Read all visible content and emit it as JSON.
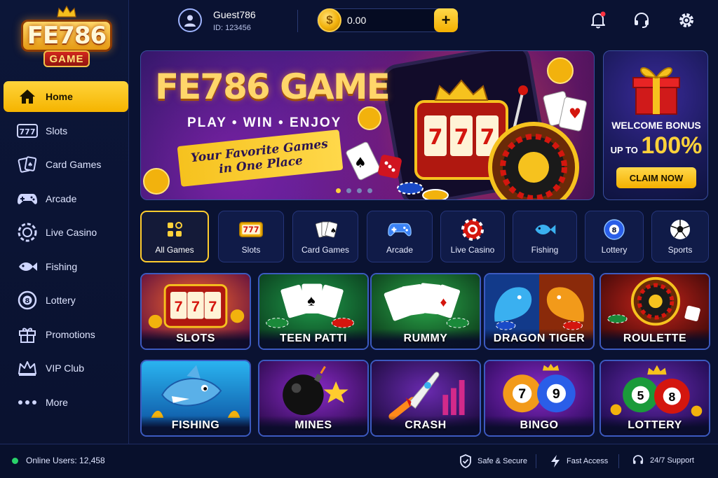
{
  "brand": {
    "logo_main": "FE786",
    "logo_sub": "GAME"
  },
  "sidebar": {
    "items": [
      {
        "label": "Home",
        "icon": "home-icon",
        "active": true
      },
      {
        "label": "Slots",
        "icon": "slots-icon"
      },
      {
        "label": "Card Games",
        "icon": "cards-icon"
      },
      {
        "label": "Arcade",
        "icon": "gamepad-icon"
      },
      {
        "label": "Live Casino",
        "icon": "chip-icon"
      },
      {
        "label": "Fishing",
        "icon": "fish-icon"
      },
      {
        "label": "Lottery",
        "icon": "lottery-ball-icon"
      },
      {
        "label": "Promotions",
        "icon": "gift-icon"
      },
      {
        "label": "VIP Club",
        "icon": "crown-icon"
      },
      {
        "label": "More",
        "icon": "more-dots-icon"
      }
    ]
  },
  "header": {
    "username": "Guest786",
    "user_id": "ID: 123456",
    "balance": "0.00",
    "add_label": "+",
    "coin_symbol": "$"
  },
  "hero": {
    "title": "FE786 GAME",
    "tagline": "PLAY • WIN • ENJOY",
    "slogan_line1": "Your Favorite Games",
    "slogan_line2": "in One Place",
    "slides_total": 4,
    "slide_active": 1
  },
  "bonus": {
    "line1": "WELCOME BONUS",
    "prefix": "UP TO",
    "amount": "100%",
    "claim_label": "CLAIM NOW"
  },
  "categories": [
    {
      "label": "All Games",
      "icon": "grid-icon",
      "active": true
    },
    {
      "label": "Slots",
      "icon": "slots-icon"
    },
    {
      "label": "Card Games",
      "icon": "cards-icon"
    },
    {
      "label": "Arcade",
      "icon": "gamepad-icon"
    },
    {
      "label": "Live Casino",
      "icon": "chip-icon"
    },
    {
      "label": "Fishing",
      "icon": "fish-icon"
    },
    {
      "label": "Lottery",
      "icon": "lottery-ball-icon"
    },
    {
      "label": "Sports",
      "icon": "soccer-ball-icon"
    }
  ],
  "games": [
    {
      "label": "SLOTS"
    },
    {
      "label": "TEEN PATTI"
    },
    {
      "label": "RUMMY"
    },
    {
      "label": "DRAGON TIGER"
    },
    {
      "label": "ROULETTE"
    },
    {
      "label": "FISHING"
    },
    {
      "label": "MINES"
    },
    {
      "label": "CRASH"
    },
    {
      "label": "BINGO"
    },
    {
      "label": "LOTTERY"
    }
  ],
  "footer": {
    "online": "Online Users: 12,458",
    "features": [
      "Safe & Secure",
      "Fast Access",
      "24/7 Support"
    ]
  },
  "colors": {
    "accent": "#ffd23a",
    "bg": "#0a1232",
    "online": "#29d26a"
  }
}
